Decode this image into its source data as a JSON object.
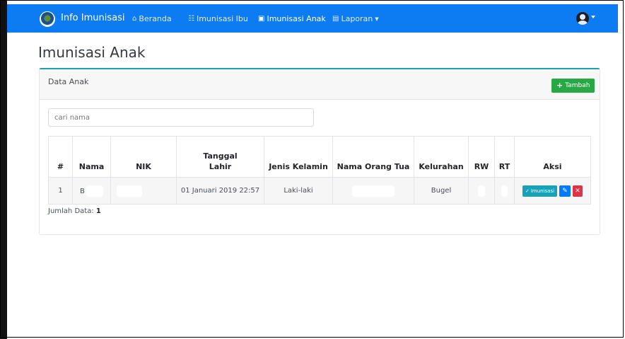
{
  "navbar": {
    "brand": "Info Imunisasi",
    "items": [
      {
        "label": "Beranda",
        "icon": "home-icon"
      },
      {
        "label": "Imunisasi Ibu",
        "icon": "users-icon"
      },
      {
        "label": "Imunisasi Anak",
        "icon": "camera-icon"
      },
      {
        "label": "Laporan",
        "icon": "clipboard-icon"
      }
    ]
  },
  "page": {
    "title": "Imunisasi Anak"
  },
  "card": {
    "title": "Data Anak",
    "add_button": "Tambah",
    "search_placeholder": "cari nama"
  },
  "table": {
    "headers": [
      "#",
      "Nama",
      "NIK",
      "Tanggal Lahir",
      "Jenis Kelamin",
      "Nama Orang Tua",
      "Kelurahan",
      "RW",
      "RT",
      "Aksi"
    ],
    "rows": [
      {
        "no": "1",
        "nama": "B",
        "nik": "",
        "tanggal_lahir": "01 Januari 2019 22:57",
        "jenis_kelamin": "Laki-laki",
        "nama_orang_tua": "",
        "kelurahan": "Bugel",
        "rw": "",
        "rt": ""
      }
    ],
    "action_imunisasi": "Imunisasi"
  },
  "footer": {
    "jumlah_label": "Jumlah Data:",
    "jumlah_value": "1"
  },
  "colors": {
    "navbar": "#0d7cf2",
    "accent": "#18a2b8",
    "success": "#28a745",
    "danger": "#dc3545",
    "primary": "#007bff"
  }
}
